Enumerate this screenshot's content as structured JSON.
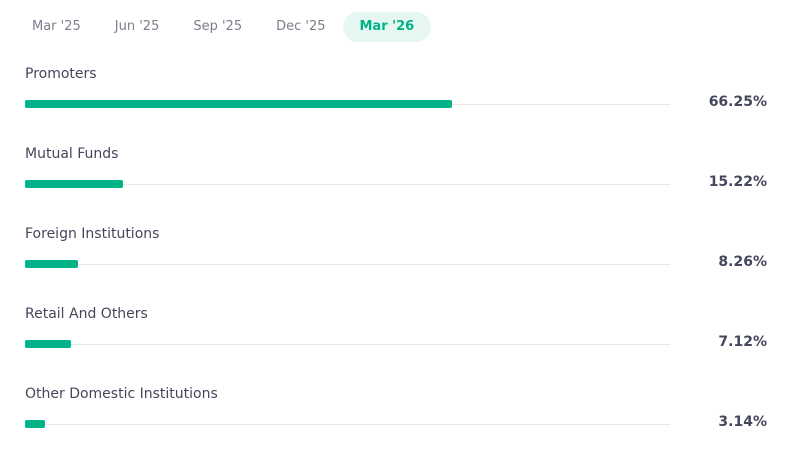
{
  "tabs": [
    {
      "label": "Mar '25",
      "active": false
    },
    {
      "label": "Jun '25",
      "active": false
    },
    {
      "label": "Sep '25",
      "active": false
    },
    {
      "label": "Dec '25",
      "active": false
    },
    {
      "label": "Mar '26",
      "active": true
    }
  ],
  "holdings": [
    {
      "label": "Promoters",
      "value": "66.25%",
      "percent": 66.25
    },
    {
      "label": "Mutual Funds",
      "value": "15.22%",
      "percent": 15.22
    },
    {
      "label": "Foreign Institutions",
      "value": "8.26%",
      "percent": 8.26
    },
    {
      "label": "Retail And Others",
      "value": "7.12%",
      "percent": 7.12
    },
    {
      "label": "Other Domestic Institutions",
      "value": "3.14%",
      "percent": 3.14
    }
  ],
  "colors": {
    "accent": "#00b386",
    "active_tab_bg": "#e6f7f1",
    "track": "#e9e9eb"
  }
}
